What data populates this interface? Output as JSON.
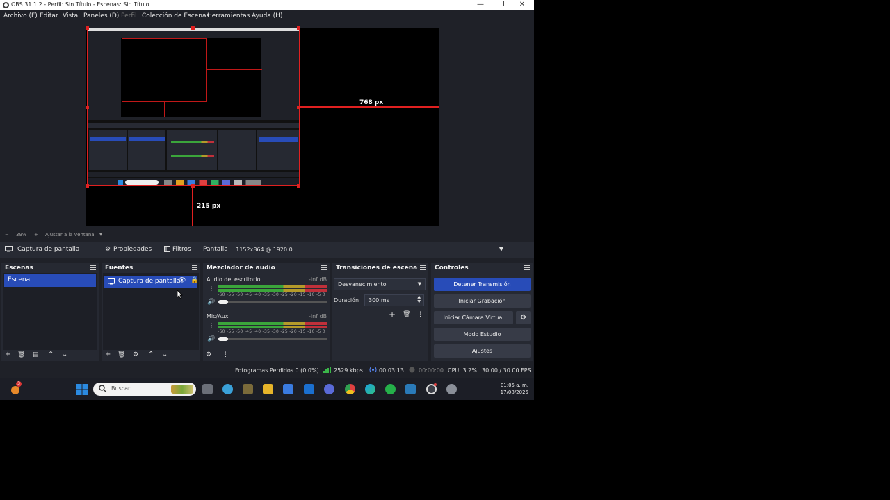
{
  "window": {
    "title": "OBS 31.1.2 - Perfil: Sin Título - Escenas: Sin Título",
    "minimize": "—",
    "maximize": "❐",
    "close": "✕"
  },
  "menu": {
    "items": [
      "Archivo (F)",
      "Editar",
      "Vista",
      "Paneles (D)",
      "Perfil",
      "Colección de Escenas",
      "Herramientas",
      "Ayuda (H)"
    ]
  },
  "preview": {
    "width_label": "768 px",
    "height_label": "215 px",
    "zoom_minus": "−",
    "zoom_value": "39%",
    "zoom_plus": "+",
    "zoom_mode": "Ajustar a la ventana"
  },
  "source_toolbar": {
    "source_name": "Captura de pantalla",
    "properties": "Propiedades",
    "filters": "Filtros",
    "display_label": "Pantalla",
    "display_value": ": 1152x864 @ 1920.0"
  },
  "scenes": {
    "title": "Escenas",
    "items": [
      "Escena"
    ]
  },
  "sources": {
    "title": "Fuentes",
    "items": [
      "Captura de pantalla"
    ]
  },
  "mixer": {
    "title": "Mezclador de audio",
    "channels": [
      {
        "name": "Audio del escritorio",
        "db": "-inf dB"
      },
      {
        "name": "Mic/Aux",
        "db": "-inf dB"
      }
    ],
    "scale": "-60 -55 -50 -45 -40 -35 -30 -25 -20 -15 -10 -5 0"
  },
  "transitions": {
    "title": "Transiciones de escena",
    "selected": "Desvanecimiento",
    "duration_label": "Duración",
    "duration_value": "300 ms"
  },
  "controls": {
    "title": "Controles",
    "stop_stream": "Detener Transmisión",
    "start_recording": "Iniciar Grabación",
    "start_virtual_cam": "Iniciar Cámara Virtual",
    "studio_mode": "Modo Estudio",
    "settings": "Ajustes"
  },
  "status": {
    "dropped_frames": "Fotogramas Perdidos 0 (0.0%)",
    "bitrate": "2529 kbps",
    "stream_time": "00:03:13",
    "record_time": "00:00:00",
    "cpu": "CPU: 3.2%",
    "fps": "30.00 / 30.00 FPS"
  },
  "taskbar": {
    "search_placeholder": "Buscar",
    "notification_count": "3",
    "time": "01:05 a. m.",
    "date": "17/08/2025"
  },
  "colors": {
    "accent": "#284cb8",
    "selection_red": "#e02020",
    "background": "#1f2128"
  }
}
